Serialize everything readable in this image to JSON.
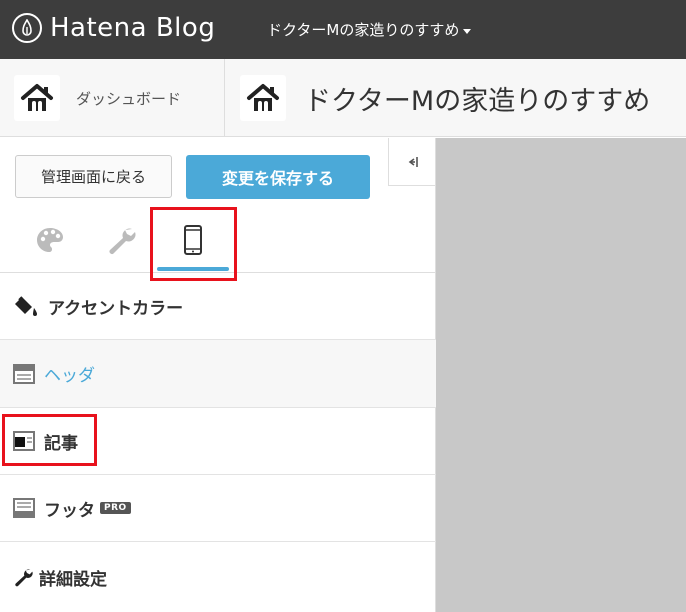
{
  "header": {
    "logo_text": "Hatena Blog",
    "blog_switcher": "ドクターMの家造りのすすめ"
  },
  "subheader": {
    "dashboard_label": "ダッシュボード",
    "blog_title": "ドクターMの家造りのすすめ"
  },
  "sidebar": {
    "back_button": "管理画面に戻る",
    "save_button": "変更を保存する",
    "tabs": [
      {
        "icon": "palette-icon"
      },
      {
        "icon": "wrench-icon"
      },
      {
        "icon": "smartphone-icon"
      }
    ],
    "menu": [
      {
        "label": "アクセントカラー",
        "icon": "paint-bucket-icon"
      },
      {
        "label": "ヘッダ",
        "icon": "header-layout-icon"
      },
      {
        "label": "記事",
        "icon": "article-layout-icon"
      },
      {
        "label": "フッタ",
        "icon": "footer-layout-icon",
        "badge": "PRO"
      },
      {
        "label": "詳細設定",
        "icon": "wrench-icon"
      }
    ]
  },
  "colors": {
    "accent": "#4ba9d8",
    "topbar": "#3d3d3d",
    "highlight": "#e8121c"
  }
}
